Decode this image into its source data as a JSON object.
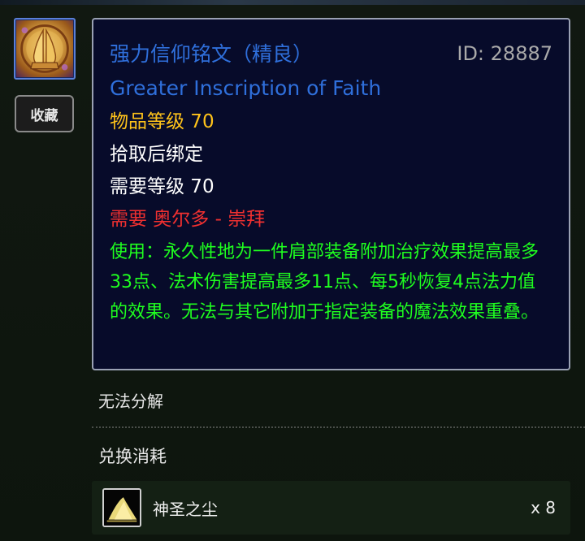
{
  "item": {
    "icon": "praying-hands-icon",
    "favorite_label": "收藏"
  },
  "tooltip": {
    "name_cn": "强力信仰铭文（精良）",
    "id_text": "ID: 28887",
    "name_en": "Greater Inscription of Faith",
    "item_level": "物品等级 70",
    "bind": "拾取后绑定",
    "required_level": "需要等级 70",
    "reputation": "需要 奥尔多 - 崇拜",
    "use_text": "使用：永久性地为一件肩部装备附加治疗效果提高最多33点、法术伤害提高最多11点、每5秒恢复4点法力值的效果。无法与其它附加于指定装备的魔法效果重叠。"
  },
  "disenchant": "无法分解",
  "exchange": {
    "title": "兑换消耗",
    "materials": [
      {
        "icon": "holy-dust-icon",
        "name": "神圣之尘",
        "qty": "x 8"
      }
    ]
  },
  "colors": {
    "quality_blue": "#2f6fdb",
    "item_level_gold": "#ffc31a",
    "requirement_red": "#f03030",
    "use_green": "#1fff1f"
  }
}
